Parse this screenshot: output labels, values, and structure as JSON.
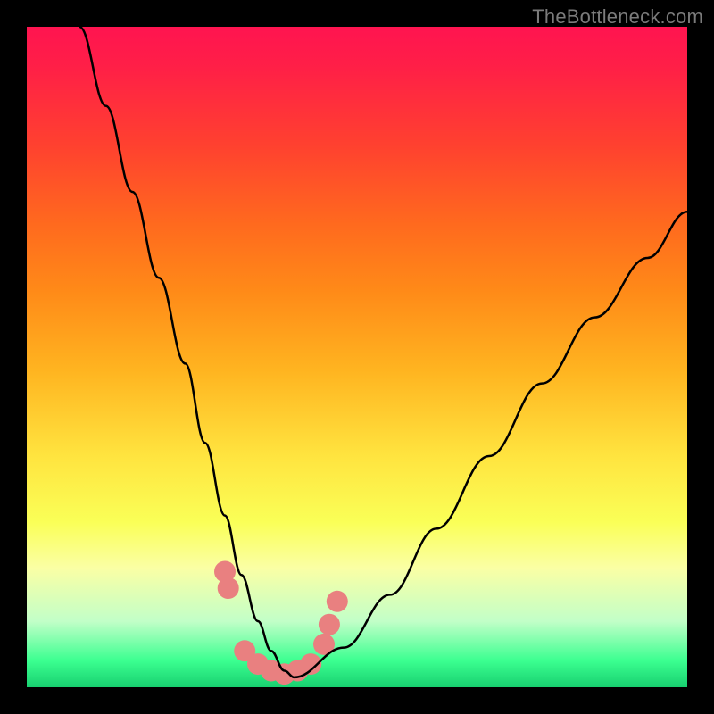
{
  "watermark": "TheBottleneck.com",
  "chart_data": {
    "type": "line",
    "title": "",
    "xlabel": "",
    "ylabel": "",
    "xlim": [
      0,
      100
    ],
    "ylim": [
      0,
      100
    ],
    "grid": false,
    "series": [
      {
        "name": "bottleneck-curve",
        "color": "#000000",
        "x": [
          8,
          12,
          16,
          20,
          24,
          27,
          30,
          32.5,
          35,
          37,
          39,
          40.5,
          48,
          55,
          62,
          70,
          78,
          86,
          94,
          100
        ],
        "values": [
          100,
          88,
          75,
          62,
          49,
          37,
          26,
          17,
          10,
          5.5,
          2.5,
          1.5,
          6,
          14,
          24,
          35,
          46,
          56,
          65,
          72
        ]
      }
    ],
    "markers": {
      "name": "highlight-dots",
      "color": "#e98080",
      "points": [
        {
          "x": 30.0,
          "y": 17.5
        },
        {
          "x": 30.5,
          "y": 15.0
        },
        {
          "x": 33.0,
          "y": 5.5
        },
        {
          "x": 35.0,
          "y": 3.5
        },
        {
          "x": 37.0,
          "y": 2.5
        },
        {
          "x": 39.0,
          "y": 2.0
        },
        {
          "x": 41.0,
          "y": 2.5
        },
        {
          "x": 43.0,
          "y": 3.5
        },
        {
          "x": 45.0,
          "y": 6.5
        },
        {
          "x": 45.8,
          "y": 9.5
        },
        {
          "x": 47.0,
          "y": 13.0
        }
      ]
    }
  }
}
